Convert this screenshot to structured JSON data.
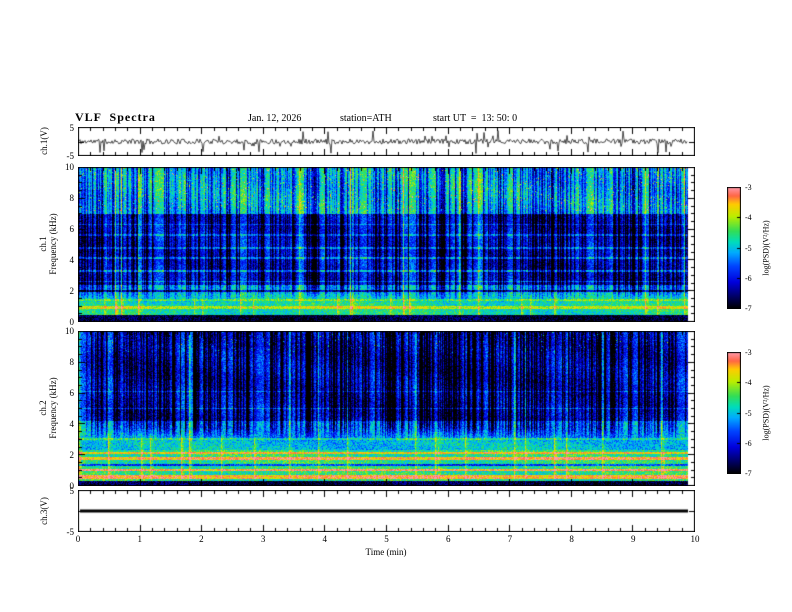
{
  "header": {
    "title": "VLF  Spectra",
    "date": "Jan. 12, 2026",
    "station": "station=ATH",
    "start_ut": "start UT  =  13: 50: 0"
  },
  "axes": {
    "xlabel": "Time (min)",
    "xticks": [
      "0",
      "1",
      "2",
      "3",
      "4",
      "5",
      "6",
      "7",
      "8",
      "9",
      "10"
    ],
    "wave_yticks": [
      "5",
      "-5"
    ],
    "spec_yticks": [
      "10",
      "8",
      "6",
      "4",
      "2",
      "0"
    ]
  },
  "labels": {
    "ch1_wave": "ch.1(V)",
    "ch3_wave": "ch.3(V)",
    "spec1_ch": "ch.1",
    "spec2_ch": "ch.2",
    "freq_axis": "Frequency (kHz)",
    "colorbar": "log(PSD)(V²/Hz)"
  },
  "colorbar": {
    "ticks": [
      "-3",
      "-4",
      "-5",
      "-6",
      "-7"
    ],
    "range": [
      -7,
      -3
    ]
  },
  "colors": {
    "background": "#ffffff",
    "axis": "#000000",
    "colormap": [
      [
        0.0,
        "#000000"
      ],
      [
        0.1,
        "#000066"
      ],
      [
        0.22,
        "#0000dd"
      ],
      [
        0.35,
        "#0044ff"
      ],
      [
        0.46,
        "#00aaff"
      ],
      [
        0.55,
        "#00ddbb"
      ],
      [
        0.64,
        "#33dd55"
      ],
      [
        0.76,
        "#bbee00"
      ],
      [
        0.86,
        "#ffcc00"
      ],
      [
        0.93,
        "#ff6644"
      ],
      [
        1.0,
        "#ff99aa"
      ]
    ]
  },
  "chart_data": [
    {
      "panel": "wave1",
      "type": "line",
      "label": "ch.1(V)",
      "xlim": [
        0,
        10
      ],
      "ylim": [
        -5,
        5
      ],
      "seed": 11,
      "noise_amp": 0.9,
      "spike_prob": 0.05,
      "spike_min": 1.5,
      "spike_max": 4.2,
      "description": "broadband noisy voltage trace centred on 0 V with frequent impulsive spikes up to ±4 V"
    },
    {
      "panel": "spec1",
      "type": "heatmap",
      "label": "ch.1 Frequency (kHz)",
      "xlim": [
        0,
        10
      ],
      "ylim": [
        0,
        10
      ],
      "colorbar_range": [
        -7,
        -3
      ],
      "seed": 21,
      "noise": 0.11,
      "bands": [
        {
          "f0": 0.0,
          "f1": 0.45,
          "v": 0.05
        },
        {
          "f0": 0.45,
          "f1": 2.4,
          "v": 0.57
        },
        {
          "f0": 2.4,
          "f1": 7.0,
          "v": 0.34
        },
        {
          "f0": 7.0,
          "f1": 10.0,
          "v": 0.62
        }
      ],
      "lines": [
        {
          "f": 0.9,
          "w": 0.08,
          "d": 0.2
        },
        {
          "f": 1.4,
          "w": 0.07,
          "d": 0.14
        },
        {
          "f": 2.0,
          "w": 0.07,
          "d": -0.32
        },
        {
          "f": 2.6,
          "w": 0.06,
          "d": 0.18
        },
        {
          "f": 3.3,
          "w": 0.07,
          "d": 0.24
        },
        {
          "f": 4.1,
          "w": 0.07,
          "d": 0.22
        },
        {
          "f": 4.8,
          "w": 0.06,
          "d": 0.2
        },
        {
          "f": 5.6,
          "w": 0.05,
          "d": 0.18
        },
        {
          "f": 6.3,
          "w": 0.05,
          "d": 0.15
        }
      ],
      "streak_fmin": 2.2,
      "streak_density": 0.42,
      "streak_strength": 0.4,
      "bright_streak_prob": 0.05,
      "hot": {
        "fmin": 7.2,
        "prob": 0.03,
        "boost": 0.38
      },
      "description": "sferic-filled VLF spectrogram: black band below 0.45 kHz, cyan-green band to 2.4 kHz, dark blue 2.4-7 kHz full of dark vertical sferic streaks and cyan hum lines, green-yellow with red specks 7-10 kHz"
    },
    {
      "panel": "spec2",
      "type": "heatmap",
      "label": "ch.2 Frequency (kHz)",
      "xlim": [
        0,
        10
      ],
      "ylim": [
        0,
        10
      ],
      "colorbar_range": [
        -7,
        -3
      ],
      "seed": 33,
      "noise": 0.12,
      "bands": [
        {
          "f0": 0.0,
          "f1": 0.3,
          "v": 0.06
        },
        {
          "f0": 0.3,
          "f1": 2.3,
          "v": 0.6
        },
        {
          "f0": 2.3,
          "f1": 4.2,
          "v": 0.5
        },
        {
          "f0": 4.2,
          "f1": 10.0,
          "v": 0.33
        }
      ],
      "lines": [
        {
          "f": 0.55,
          "w": 0.1,
          "d": 0.3
        },
        {
          "f": 1.0,
          "w": 0.08,
          "d": 0.34
        },
        {
          "f": 1.35,
          "w": 0.07,
          "d": -0.28
        },
        {
          "f": 1.75,
          "w": 0.08,
          "d": 0.3
        },
        {
          "f": 2.1,
          "w": 0.06,
          "d": 0.26
        },
        {
          "f": 3.0,
          "w": 0.06,
          "d": 0.14
        },
        {
          "f": 5.0,
          "w": 0.05,
          "d": 0.18
        },
        {
          "f": 6.1,
          "w": 0.05,
          "d": 0.14
        }
      ],
      "streak_fmin": 3.8,
      "streak_density": 0.48,
      "streak_strength": 0.42,
      "bright_streak_prob": 0.04,
      "hot": {
        "fmin": 8.6,
        "prob": 0.02,
        "boost": 0.3
      },
      "description": "second channel spectrogram: bright orange-red horizontal harmonic lines below 2.3 kHz, green mid band, dark blue streaky region 4.2-10 kHz"
    },
    {
      "panel": "wave3",
      "type": "line",
      "label": "ch.3(V)",
      "xlim": [
        0,
        10
      ],
      "ylim": [
        -5,
        5
      ],
      "flat_value": 0,
      "description": "flat thick black trace at 0 V (no signal on channel 3)"
    }
  ]
}
